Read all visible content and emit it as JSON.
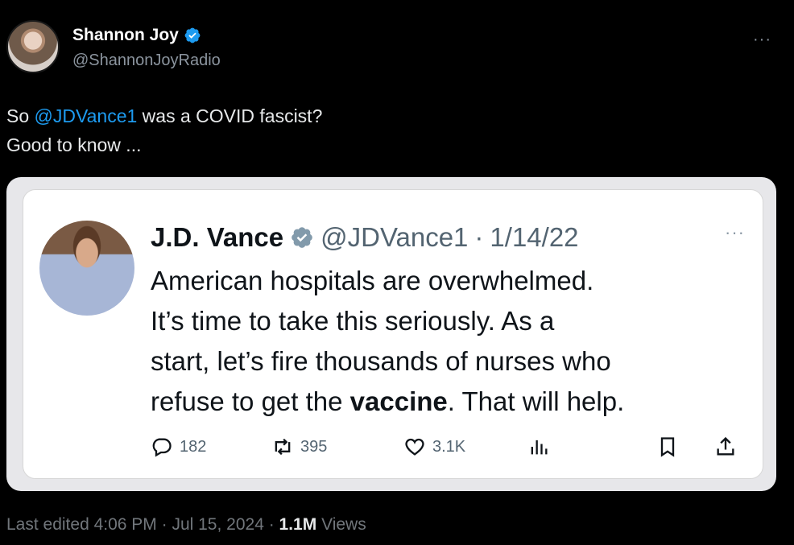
{
  "post": {
    "author_name": "Shannon Joy",
    "author_handle": "@ShannonJoyRadio",
    "text_prefix": "So ",
    "mention": "@JDVance1",
    "text_suffix": " was a COVID fascist?",
    "text_line2": "Good to know ...",
    "more_label": "···"
  },
  "quote": {
    "author_name": "J.D. Vance",
    "author_handle": "@JDVance1",
    "separator": "·",
    "date": "1/14/22",
    "more_label": "···",
    "body_line1": "American hospitals are overwhelmed.",
    "body_line2": "It’s time to take this seriously.  As a",
    "body_line3": "start, let’s fire thousands of nurses who",
    "body_line4_pre": "refuse to get the ",
    "body_line4_bold": "vaccine",
    "body_line4_post": ". That will help.",
    "replies": "182",
    "reposts": "395",
    "likes": "3.1K"
  },
  "footer": {
    "edited_text": "Last edited 4:06 PM · Jul 15, 2024 · ",
    "views_count": "1.1M",
    "views_label": " Views"
  },
  "colors": {
    "link_blue": "#1d9bf0",
    "verified_blue": "#1d9bf0",
    "verified_gray": "#829aab",
    "background": "#000000"
  }
}
